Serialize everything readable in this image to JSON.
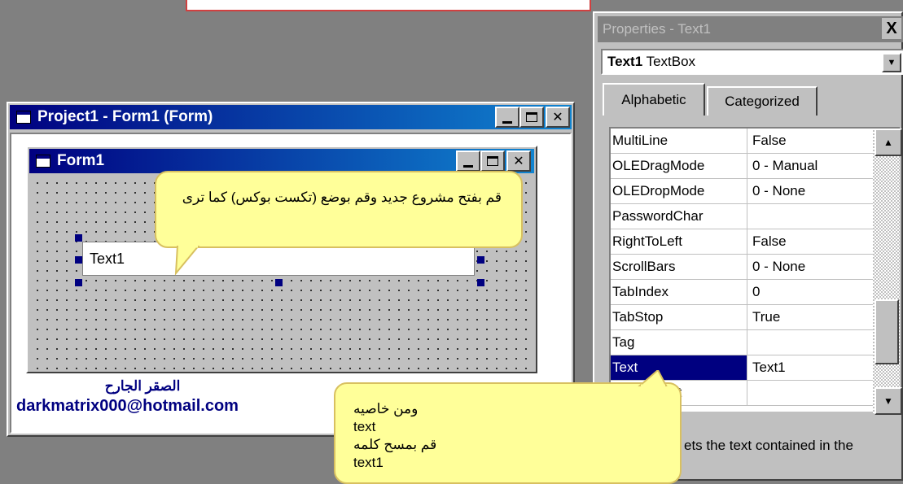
{
  "project_window": {
    "title": "Project1 - Form1 (Form)"
  },
  "form1": {
    "title": "Form1",
    "textbox_text": "Text1"
  },
  "author": {
    "name": "الصقر الجارح",
    "email": "darkmatrix000@hotmail.com"
  },
  "properties": {
    "title": "Properties - Text1",
    "close_label": "X",
    "object_name": "Text1",
    "object_type": "TextBox",
    "tabs": [
      "Alphabetic",
      "Categorized"
    ],
    "rows": [
      {
        "name": "MultiLine",
        "value": "False"
      },
      {
        "name": "OLEDragMode",
        "value": "0 - Manual"
      },
      {
        "name": "OLEDropMode",
        "value": "0 - None"
      },
      {
        "name": "PasswordChar",
        "value": ""
      },
      {
        "name": "RightToLeft",
        "value": "False"
      },
      {
        "name": "ScrollBars",
        "value": "0 - None"
      },
      {
        "name": "TabIndex",
        "value": "0"
      },
      {
        "name": "TabStop",
        "value": "True"
      },
      {
        "name": "Tag",
        "value": ""
      },
      {
        "name": "Text",
        "value": "Text1"
      },
      {
        "name": "ToolTipText",
        "value": ""
      }
    ],
    "selected_row": "Text",
    "description": "ets the text contained in the"
  },
  "callouts": {
    "first": "قم بفتح مشروع جديد وقم بوضع (تكست بوكس) كما ترى",
    "second": [
      "ومن خاصيه",
      "text",
      "قم بمسح كلمه",
      "text1"
    ]
  },
  "colors": {
    "title_active": "#000080",
    "title_inactive": "#808080",
    "callout_fill": "#ffff99",
    "author_text": "#000080"
  }
}
